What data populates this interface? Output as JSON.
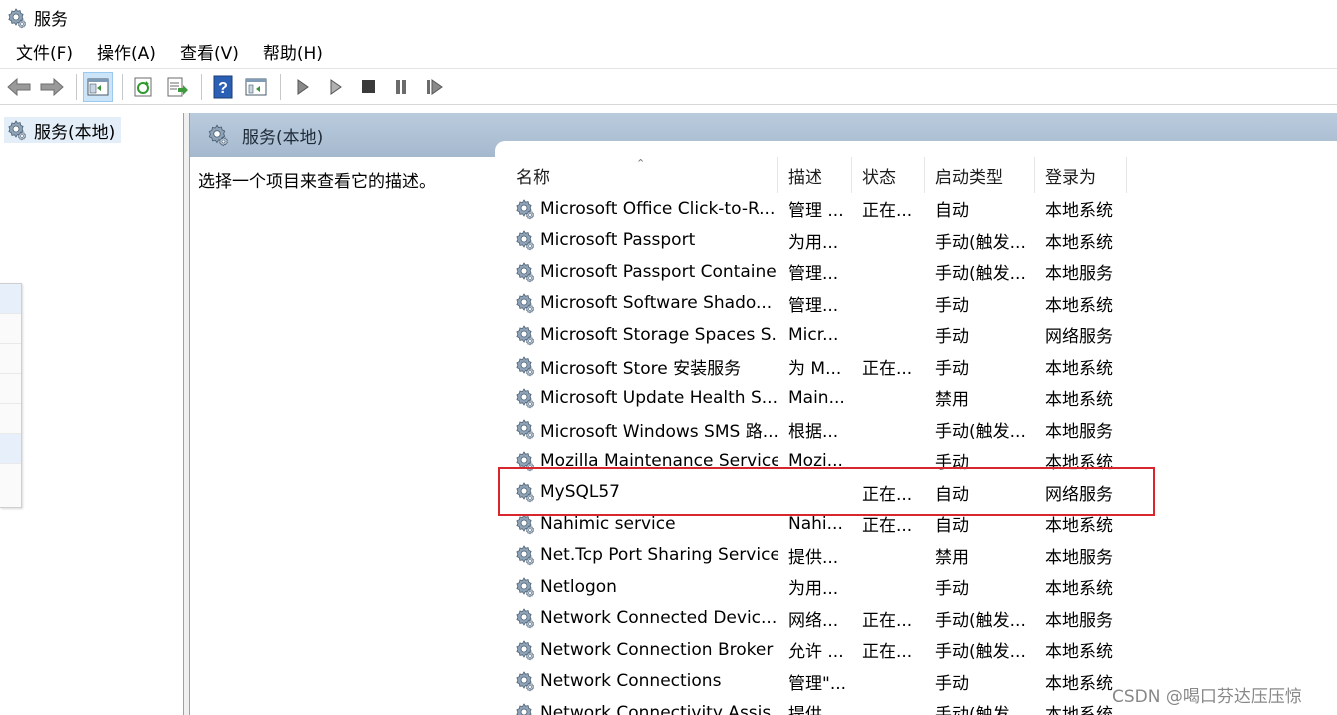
{
  "window": {
    "title": "服务"
  },
  "menu": [
    "文件(F)",
    "操作(A)",
    "查看(V)",
    "帮助(H)"
  ],
  "toolbar": {
    "buttons": [
      "back-icon",
      "forward-icon",
      "show-tree-icon",
      "refresh-icon",
      "export-list-icon",
      "help-icon",
      "properties-icon",
      "start-icon",
      "start-alt-icon",
      "stop-icon",
      "pause-icon",
      "resume-icon"
    ]
  },
  "tree": {
    "root_label": "服务(本地)"
  },
  "main": {
    "header_label": "服务(本地)",
    "description_prompt": "选择一个项目来查看它的描述。",
    "columns": [
      "名称",
      "描述",
      "状态",
      "启动类型",
      "登录为"
    ],
    "rows": [
      {
        "name": "Microsoft Office Click-to-R...",
        "desc": "管理 ...",
        "state": "正在...",
        "start": "自动",
        "logon": "本地系统"
      },
      {
        "name": "Microsoft Passport",
        "desc": "为用...",
        "state": "",
        "start": "手动(触发...",
        "logon": "本地系统"
      },
      {
        "name": "Microsoft Passport Container",
        "desc": "管理...",
        "state": "",
        "start": "手动(触发...",
        "logon": "本地服务"
      },
      {
        "name": "Microsoft Software Shado...",
        "desc": "管理...",
        "state": "",
        "start": "手动",
        "logon": "本地系统"
      },
      {
        "name": "Microsoft Storage Spaces S...",
        "desc": "Micr...",
        "state": "",
        "start": "手动",
        "logon": "网络服务"
      },
      {
        "name": "Microsoft Store 安装服务",
        "desc": "为 M...",
        "state": "正在...",
        "start": "手动",
        "logon": "本地系统"
      },
      {
        "name": "Microsoft Update Health S...",
        "desc": "Main...",
        "state": "",
        "start": "禁用",
        "logon": "本地系统"
      },
      {
        "name": "Microsoft Windows SMS 路...",
        "desc": "根据...",
        "state": "",
        "start": "手动(触发...",
        "logon": "本地服务"
      },
      {
        "name": "Mozilla Maintenance Service",
        "desc": "Mozi...",
        "state": "",
        "start": "手动",
        "logon": "本地系统"
      },
      {
        "name": "MySQL57",
        "desc": "",
        "state": "正在...",
        "start": "自动",
        "logon": "网络服务"
      },
      {
        "name": "Nahimic service",
        "desc": "Nahi...",
        "state": "正在...",
        "start": "自动",
        "logon": "本地系统"
      },
      {
        "name": "Net.Tcp Port Sharing Service",
        "desc": "提供...",
        "state": "",
        "start": "禁用",
        "logon": "本地服务"
      },
      {
        "name": "Netlogon",
        "desc": "为用...",
        "state": "",
        "start": "手动",
        "logon": "本地系统"
      },
      {
        "name": "Network Connected Devic...",
        "desc": "网络...",
        "state": "正在...",
        "start": "手动(触发...",
        "logon": "本地服务"
      },
      {
        "name": "Network Connection Broker",
        "desc": "允许 ...",
        "state": "正在...",
        "start": "手动(触发...",
        "logon": "本地系统"
      },
      {
        "name": "Network Connections",
        "desc": "管理\"...",
        "state": "",
        "start": "手动",
        "logon": "本地系统"
      },
      {
        "name": "Network Connectivity Assis...",
        "desc": "提供...",
        "state": "",
        "start": "手动(触发...",
        "logon": "本地系统"
      }
    ]
  },
  "watermark": "CSDN @喝口芬达压压惊",
  "colors": {
    "header_bg": "#a5b9ce",
    "highlight_border": "#d8262e",
    "tree_selected": "#e3eef9"
  }
}
